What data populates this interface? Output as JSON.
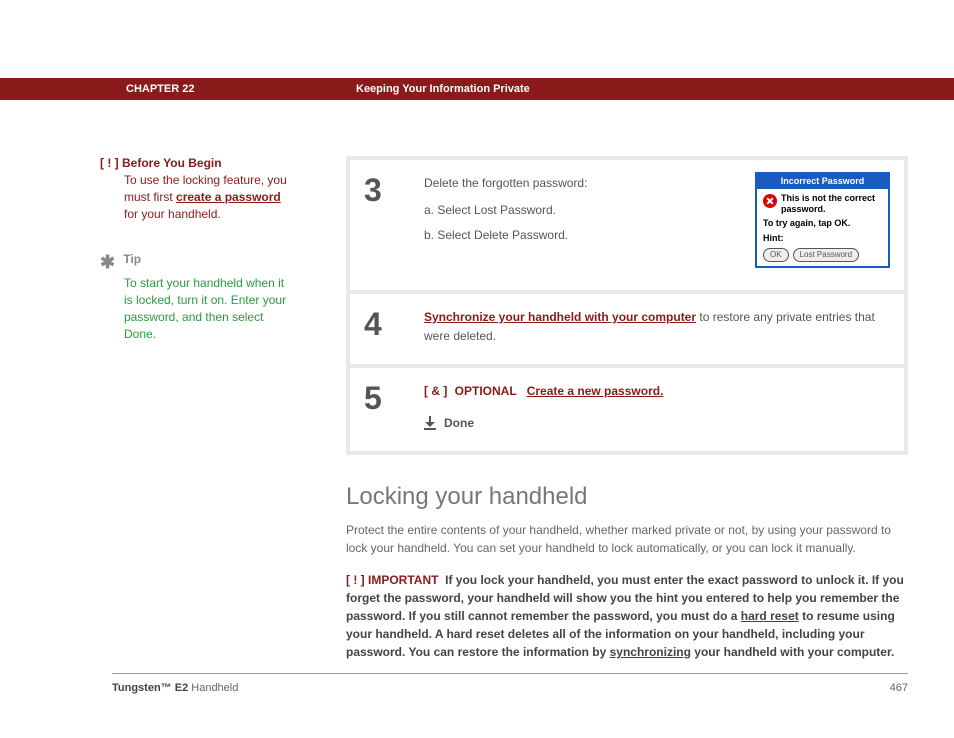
{
  "header": {
    "chapter": "CHAPTER 22",
    "title": "Keeping Your Information Private"
  },
  "sidebar": {
    "before": {
      "marker": "[ ! ]",
      "title": "Before You Begin",
      "pre": "To use the locking feature, you must first ",
      "link": "create a password",
      "post": " for your handheld."
    },
    "tip": {
      "star": "✱",
      "label": "Tip",
      "body": "To start your handheld when it is locked, turn it on. Enter your password, and then select Done."
    }
  },
  "steps": {
    "s3": {
      "num": "3",
      "lead": "Delete the forgotten password:",
      "a": "a.   Select Lost Password.",
      "b": "b.   Select Delete Password."
    },
    "s4": {
      "num": "4",
      "link": "Synchronize your handheld with your computer",
      "post": " to restore any private entries that were deleted."
    },
    "s5": {
      "num": "5",
      "marker": "[ & ]",
      "optional": "OPTIONAL",
      "link": "Create a new password.",
      "done": "Done"
    }
  },
  "dialog": {
    "title": "Incorrect Password",
    "msg": "This is not the correct password.",
    "try": "To try again, tap OK.",
    "hint": "Hint:",
    "ok": "OK",
    "lost": "Lost Password"
  },
  "section": {
    "title": "Locking your handheld",
    "body": "Protect the entire contents of your handheld, whether marked private or not, by using your password to lock your handheld. You can set your handheld to lock automatically, or you can lock it manually."
  },
  "important": {
    "marker": "[ ! ]",
    "label": "IMPORTANT",
    "t1": "If you lock your handheld, you must enter the exact password to unlock it. If you forget the password, your handheld will show you the hint you entered to help you remember the password. If you still cannot remember the password, you must do a ",
    "link1": "hard reset",
    "t2": " to resume using your handheld. A hard reset deletes all of the information on your handheld, including your password. You can restore the information by ",
    "link2": "synchronizing",
    "t3": " your handheld with your computer."
  },
  "footer": {
    "product_bold": "Tungsten™ E2",
    "product_rest": " Handheld",
    "page": "467"
  }
}
